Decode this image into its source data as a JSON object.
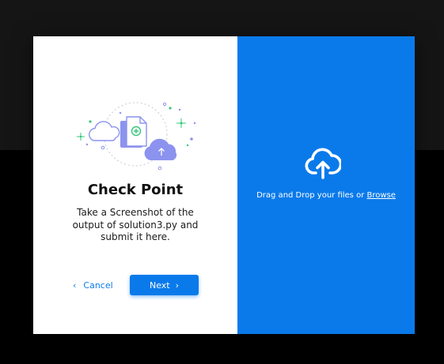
{
  "dialog": {
    "title": "Check Point",
    "description_lines": [
      "Take a Screenshot of  the",
      "output of solution3.py and",
      "submit it here."
    ],
    "cancel_label": "Cancel",
    "next_label": "Next",
    "chevron_left": "‹",
    "chevron_right": "›"
  },
  "dropzone": {
    "text": "Drag and Drop your files or ",
    "browse_label": "Browse",
    "icon": "cloud-upload-icon"
  },
  "illustration": {
    "icon": "file-cloud-upload-illustration"
  },
  "colors": {
    "accent": "#0a7aea",
    "backdrop": "#000000",
    "backdrop_band": "#151515",
    "illustration_purple": "#8b93ef",
    "illustration_green": "#34c77a"
  }
}
